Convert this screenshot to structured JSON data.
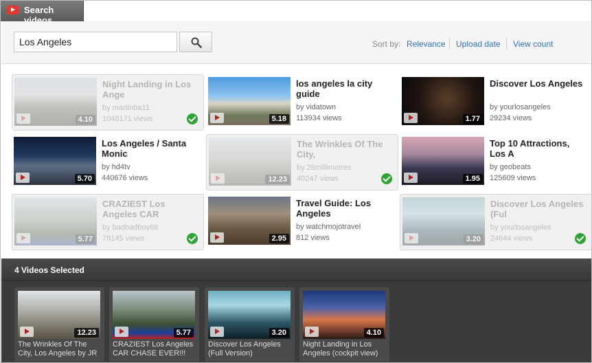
{
  "window": {
    "title": "Search videos",
    "icon": "youtube-play-icon"
  },
  "search": {
    "value": "Los Angeles",
    "button_icon": "magnifier-icon"
  },
  "sort": {
    "label": "Sort by:",
    "options": [
      "Relevance",
      "Upload date",
      "View count"
    ]
  },
  "results": [
    {
      "title": "Night Landing in Los Ange",
      "author": "by martinba11",
      "views": "1048171 views",
      "duration": "4.10",
      "selected": true
    },
    {
      "title": "los angeles la city guide",
      "author": "by vidatown",
      "views": "113934 views",
      "duration": "5.18",
      "selected": false
    },
    {
      "title": "Discover Los Angeles",
      "author": "by yourlosangeles",
      "views": "29234 views",
      "duration": "1.77",
      "selected": false
    },
    {
      "title": "Los Angeles / Santa Monic",
      "author": "by hd4tv",
      "views": "440676 views",
      "duration": "5.70",
      "selected": false
    },
    {
      "title": "The Wrinkles Of The City,",
      "author": "by 28millimetres",
      "views": "40247 views",
      "duration": "12.23",
      "selected": true
    },
    {
      "title": "Top 10 Attractions, Los A",
      "author": "by geobeats",
      "views": "125609 views",
      "duration": "1.95",
      "selected": false
    },
    {
      "title": "CRAZIEST Los Angeles CAR",
      "author": "by badbadboy68",
      "views": "78145 views",
      "duration": "5.77",
      "selected": true
    },
    {
      "title": "Travel Guide: Los Angeles",
      "author": "by watchmojotravel",
      "views": "812 views",
      "duration": "2.95",
      "selected": false
    },
    {
      "title": "Discover Los Angeles (Ful",
      "author": "by yourlosangeles",
      "views": "24644 views",
      "duration": "3.20",
      "selected": true
    }
  ],
  "tray": {
    "heading": "4 Videos Selected",
    "items": [
      {
        "label": "The Wrinkles Of The City, Los Angeles by JR",
        "duration": "12.23"
      },
      {
        "label": "CRAZIEST Los Angeles CAR CHASE EVER!!!",
        "duration": "5.77"
      },
      {
        "label": "Discover Los Angeles (Full Version)",
        "duration": "3.20"
      },
      {
        "label": "Night Landing in Los Angeles (cockpit view)",
        "duration": "4.10"
      }
    ]
  }
}
